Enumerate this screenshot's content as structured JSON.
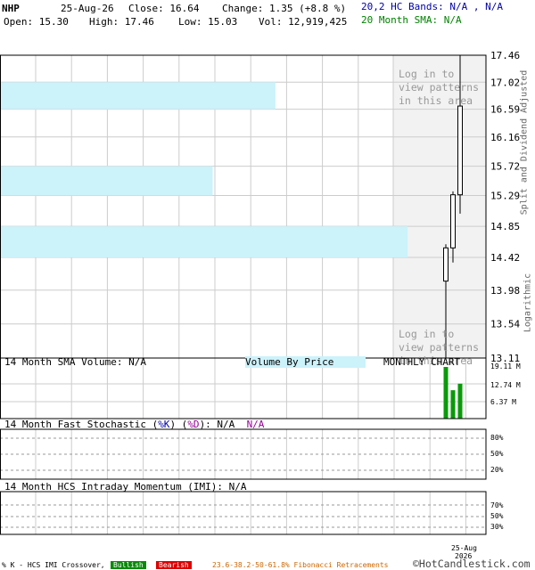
{
  "header": {
    "symbol": "NHP",
    "date": "25-Aug-26",
    "close_label": "Close: 16.64",
    "change_label": "Change: 1.35 (+8.8 %)",
    "open_label": "Open: 15.30",
    "high_label": "High: 17.46",
    "low_label": "Low: 15.03",
    "vol_label": "Vol: 12,919,425",
    "hc_bands": "20,2 HC Bands: N/A , N/A",
    "sma20": "20 Month SMA: N/A"
  },
  "overlay": {
    "login_line1": "Log in to",
    "login_line2": "view patterns",
    "login_line3": "in this area"
  },
  "side_labels": {
    "split": "Split and Dividend Adjusted",
    "log": "Logarithmic"
  },
  "volume_panel": {
    "sma_label": "14 Month SMA Volume: N/A",
    "vbp_label": "Volume By Price",
    "monthly_label": "MONTHLY CHART",
    "ticks": [
      "19.11 M",
      "12.74 M",
      "6.37 M"
    ]
  },
  "stoch_panel": {
    "label_a": "14 Month Fast Stochastic (",
    "label_k": "%K",
    "label_b": ") (",
    "label_d": "%D",
    "label_c": "): N/A",
    "label_na": "N/A",
    "ticks": [
      "80%",
      "50%",
      "20%"
    ]
  },
  "imi_panel": {
    "label": "14 Month HCS Intraday Momentum (IMI): N/A",
    "ticks": [
      "70%",
      "50%",
      "30%"
    ]
  },
  "footer": {
    "xlabel_month": "25-Aug",
    "xlabel_year": "2026",
    "legend_text": "% K - HCS IMI Crossover,",
    "bullish": "Bullish",
    "bearish": "Bearish",
    "fib": "23.6-38.2-50-61.8% Fibonacci Retracements",
    "copyright": "©HotCandlestick.com"
  },
  "colors": {
    "vbp_bar": "#ccf2fa",
    "up_volume": "#0a9a0a",
    "grid": "#cccccc",
    "bullish": "#0a8a0a",
    "bearish": "#dd0000",
    "fib": "#cc6600",
    "d_line": "#990099"
  },
  "chart_data": {
    "type": "candlestick",
    "scale": "log",
    "ylim": [
      13.11,
      17.46
    ],
    "price_ticks": [
      17.46,
      17.02,
      16.59,
      16.16,
      15.72,
      15.29,
      14.85,
      14.42,
      13.98,
      13.54,
      13.11
    ],
    "candles": [
      {
        "open": 14.1,
        "high": 14.6,
        "low": 13.11,
        "close": 14.55
      },
      {
        "open": 14.55,
        "high": 15.35,
        "low": 14.35,
        "close": 15.3
      },
      {
        "open": 15.3,
        "high": 17.46,
        "low": 15.03,
        "close": 16.64
      }
    ],
    "volume_by_price": [
      {
        "price_low": 16.59,
        "price_high": 17.02,
        "relative_volume": 0.665
      },
      {
        "price_low": 15.29,
        "price_high": 15.72,
        "relative_volume": 0.513
      },
      {
        "price_low": 14.42,
        "price_high": 14.85,
        "relative_volume": 0.985
      }
    ],
    "volume_ylim": [
      0,
      19.11
    ],
    "volume_m": [
      19.11,
      10.5,
      12.92
    ]
  }
}
